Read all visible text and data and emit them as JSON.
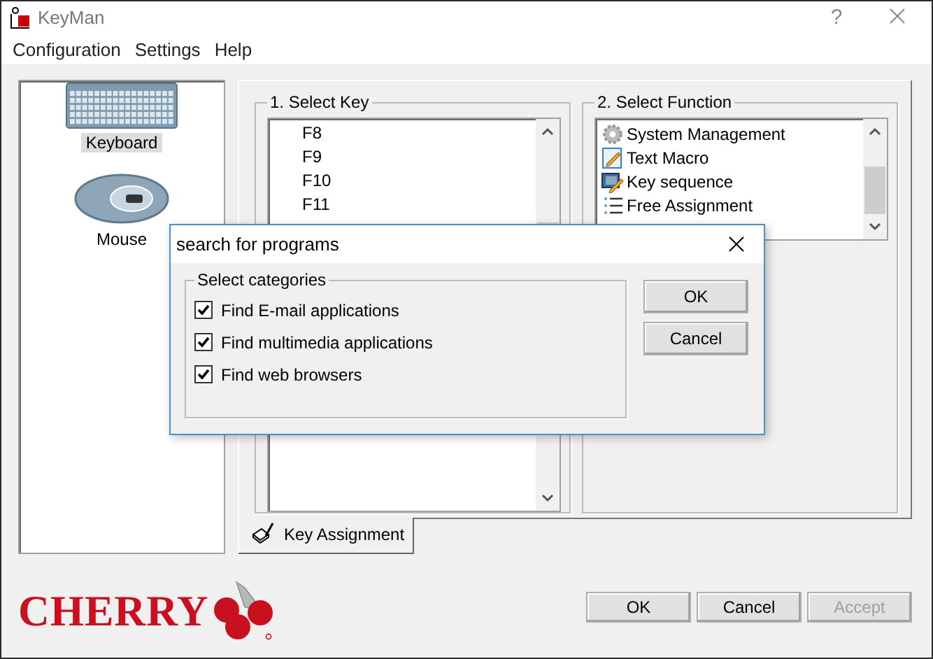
{
  "window": {
    "title": "KeyMan",
    "help": "?"
  },
  "menu": [
    "Configuration",
    "Settings",
    "Help"
  ],
  "sidebar": {
    "items": [
      {
        "label": "Keyboard",
        "kind": "keyboard",
        "selected": true
      },
      {
        "label": "Mouse",
        "kind": "mouse",
        "selected": false
      }
    ]
  },
  "select_key": {
    "title": "1. Select Key",
    "items": [
      "F8",
      "F9",
      "F10",
      "F11"
    ]
  },
  "select_function": {
    "title": "2. Select Function",
    "items": [
      {
        "label": "System Management",
        "kind": "gear"
      },
      {
        "label": "Text Macro",
        "kind": "macro"
      },
      {
        "label": "Key sequence",
        "kind": "sequence"
      },
      {
        "label": "Free Assignment",
        "kind": "list"
      }
    ]
  },
  "tab": {
    "label": "Key Assignment",
    "selected": true
  },
  "logo": "CHERRY",
  "buttons": [
    {
      "label": "OK",
      "disabled": false
    },
    {
      "label": "Cancel",
      "disabled": false
    },
    {
      "label": "Accept",
      "disabled": true
    }
  ],
  "dialog": {
    "title": "search for programs",
    "group": "Select categories",
    "options": [
      {
        "label": "Find E-mail applications",
        "checked": true
      },
      {
        "label": "Find multimedia applications",
        "checked": true
      },
      {
        "label": "Find web browsers",
        "checked": true
      }
    ],
    "buttons": [
      "OK",
      "Cancel"
    ]
  }
}
